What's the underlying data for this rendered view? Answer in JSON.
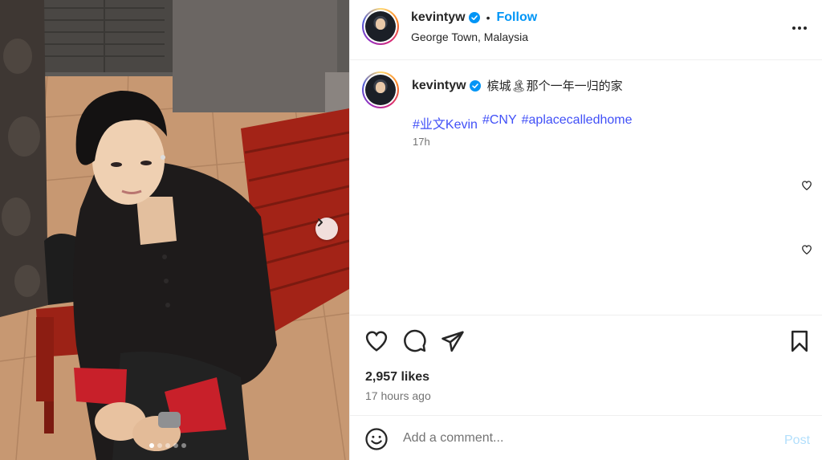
{
  "post": {
    "username": "kevintyw",
    "separator": "•",
    "follow_label": "Follow",
    "location": "George Town, Malaysia",
    "caption_text": "槟城🏝那个一年一归的家",
    "hashtags": [
      "#业文Kevin",
      "#CNY",
      "#aplacecalledhome"
    ],
    "caption_age": "17h",
    "likes": "2,957 likes",
    "posted_ago": "17 hours ago"
  },
  "comment_box": {
    "placeholder": "Add a comment...",
    "post_label": "Post"
  },
  "carousel": {
    "slide_count": 5,
    "active_index": 0
  },
  "icons": {
    "verified": "verified-badge-icon",
    "more": "more-options-icon",
    "like": "heart-icon",
    "comment": "comment-bubble-icon",
    "share": "paper-plane-icon",
    "save": "bookmark-icon",
    "emoji": "smiley-icon",
    "next": "chevron-right-icon"
  },
  "colors": {
    "link_blue": "#0095f6",
    "hashtag_blue": "#4150f7",
    "post_disabled": "#b2dffc",
    "verified_blue": "#0095f6"
  }
}
